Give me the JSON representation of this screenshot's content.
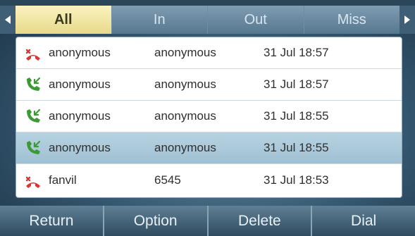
{
  "tabs": [
    "All",
    "In",
    "Out",
    "Miss"
  ],
  "active_tab": "All",
  "nav": {
    "left_icon": "triangle-left-icon",
    "right_icon": "triangle-right-icon"
  },
  "calls": [
    {
      "type": "missed",
      "icon": "missed-call-icon",
      "name": "anonymous",
      "number": "anonymous",
      "time": "31 Jul 18:57",
      "selected": false
    },
    {
      "type": "received",
      "icon": "received-call-icon",
      "name": "anonymous",
      "number": "anonymous",
      "time": "31 Jul 18:57",
      "selected": false
    },
    {
      "type": "received",
      "icon": "received-call-icon",
      "name": "anonymous",
      "number": "anonymous",
      "time": "31 Jul 18:55",
      "selected": false
    },
    {
      "type": "received",
      "icon": "received-call-icon",
      "name": "anonymous",
      "number": "anonymous",
      "time": "31 Jul 18:55",
      "selected": true
    },
    {
      "type": "missed",
      "icon": "missed-call-icon",
      "name": "fanvil",
      "number": "6545",
      "time": "31 Jul 18:53",
      "selected": false
    }
  ],
  "softkeys": [
    "Return",
    "Option",
    "Delete",
    "Dial"
  ],
  "colors": {
    "missed": "#d83535",
    "received": "#3c9a35",
    "active_tab": "#f3e7a4",
    "selected_row": "#a9c8da"
  }
}
